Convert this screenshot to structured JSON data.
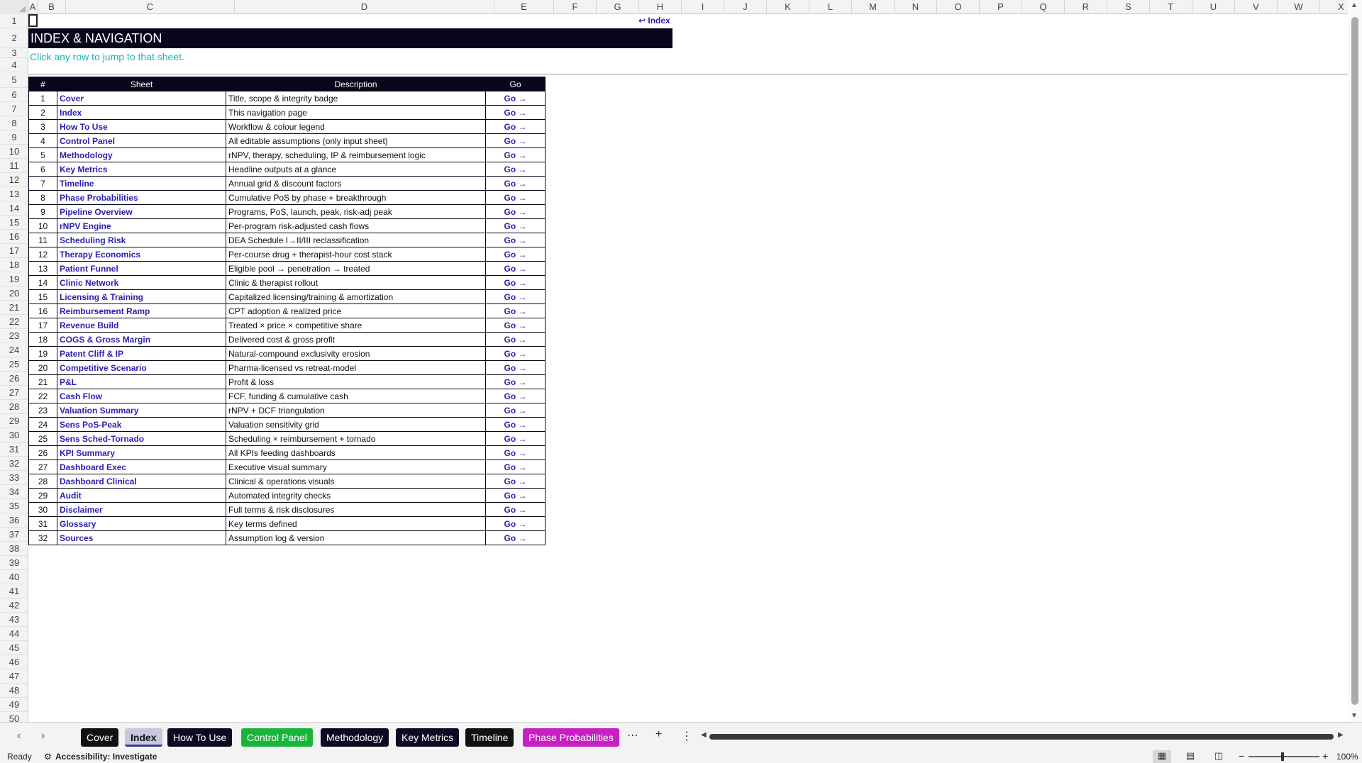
{
  "columns": [
    "A",
    "B",
    "C",
    "D",
    "E",
    "F",
    "G",
    "H",
    "I",
    "J",
    "K",
    "L",
    "M",
    "N",
    "O",
    "P",
    "Q",
    "R",
    "S",
    "T",
    "U",
    "V",
    "W",
    "X"
  ],
  "rows_start": 1,
  "rows_end": 50,
  "back_link": "↩ Index",
  "title": "INDEX & NAVIGATION",
  "subtitle": "Click any row to jump to that sheet.",
  "table": {
    "headers": {
      "num": "#",
      "sheet": "Sheet",
      "desc": "Description",
      "go": "Go"
    },
    "rows": [
      {
        "num": "1",
        "sheet": "Cover",
        "desc": "Title, scope & integrity badge",
        "go": "Go →"
      },
      {
        "num": "2",
        "sheet": "Index",
        "desc": "This navigation page",
        "go": "Go →"
      },
      {
        "num": "3",
        "sheet": "How To Use",
        "desc": "Workflow & colour legend",
        "go": "Go →"
      },
      {
        "num": "4",
        "sheet": "Control Panel",
        "desc": "All editable assumptions (only input sheet)",
        "go": "Go →"
      },
      {
        "num": "5",
        "sheet": "Methodology",
        "desc": "rNPV, therapy, scheduling, IP & reimbursement logic",
        "go": "Go →"
      },
      {
        "num": "6",
        "sheet": "Key Metrics",
        "desc": "Headline outputs at a glance",
        "go": "Go →"
      },
      {
        "num": "7",
        "sheet": "Timeline",
        "desc": "Annual grid & discount factors",
        "go": "Go →"
      },
      {
        "num": "8",
        "sheet": "Phase Probabilities",
        "desc": "Cumulative PoS by phase + breakthrough",
        "go": "Go →"
      },
      {
        "num": "9",
        "sheet": "Pipeline Overview",
        "desc": "Programs, PoS, launch, peak, risk-adj peak",
        "go": "Go →"
      },
      {
        "num": "10",
        "sheet": "rNPV Engine",
        "desc": "Per-program risk-adjusted cash flows",
        "go": "Go →"
      },
      {
        "num": "11",
        "sheet": "Scheduling Risk",
        "desc": "DEA Schedule I→II/III reclassification",
        "go": "Go →"
      },
      {
        "num": "12",
        "sheet": "Therapy Economics",
        "desc": "Per-course drug + therapist-hour cost stack",
        "go": "Go →"
      },
      {
        "num": "13",
        "sheet": "Patient Funnel",
        "desc": "Eligible pool → penetration → treated",
        "go": "Go →"
      },
      {
        "num": "14",
        "sheet": "Clinic Network",
        "desc": "Clinic & therapist rollout",
        "go": "Go →"
      },
      {
        "num": "15",
        "sheet": "Licensing & Training",
        "desc": "Capitalized licensing/training & amortization",
        "go": "Go →"
      },
      {
        "num": "16",
        "sheet": "Reimbursement Ramp",
        "desc": "CPT adoption & realized price",
        "go": "Go →"
      },
      {
        "num": "17",
        "sheet": "Revenue Build",
        "desc": "Treated × price × competitive share",
        "go": "Go →"
      },
      {
        "num": "18",
        "sheet": "COGS & Gross Margin",
        "desc": "Delivered cost & gross profit",
        "go": "Go →"
      },
      {
        "num": "19",
        "sheet": "Patent Cliff & IP",
        "desc": "Natural-compound exclusivity erosion",
        "go": "Go →"
      },
      {
        "num": "20",
        "sheet": "Competitive Scenario",
        "desc": "Pharma-licensed vs retreat-model",
        "go": "Go →"
      },
      {
        "num": "21",
        "sheet": "P&L",
        "desc": "Profit & loss",
        "go": "Go →"
      },
      {
        "num": "22",
        "sheet": "Cash Flow",
        "desc": "FCF, funding & cumulative cash",
        "go": "Go →"
      },
      {
        "num": "23",
        "sheet": "Valuation Summary",
        "desc": "rNPV + DCF triangulation",
        "go": "Go →"
      },
      {
        "num": "24",
        "sheet": "Sens PoS-Peak",
        "desc": "Valuation sensitivity grid",
        "go": "Go →"
      },
      {
        "num": "25",
        "sheet": "Sens Sched-Tornado",
        "desc": "Scheduling × reimbursement + tornado",
        "go": "Go →"
      },
      {
        "num": "26",
        "sheet": "KPI Summary",
        "desc": "All KPIs feeding dashboards",
        "go": "Go →"
      },
      {
        "num": "27",
        "sheet": "Dashboard Exec",
        "desc": "Executive visual summary",
        "go": "Go →"
      },
      {
        "num": "28",
        "sheet": "Dashboard Clinical",
        "desc": "Clinical & operations visuals",
        "go": "Go →"
      },
      {
        "num": "29",
        "sheet": "Audit",
        "desc": "Automated integrity checks",
        "go": "Go →"
      },
      {
        "num": "30",
        "sheet": "Disclaimer",
        "desc": "Full terms & risk disclosures",
        "go": "Go →"
      },
      {
        "num": "31",
        "sheet": "Glossary",
        "desc": "Key terms defined",
        "go": "Go →"
      },
      {
        "num": "32",
        "sheet": "Sources",
        "desc": "Assumption log & version",
        "go": "Go →"
      }
    ]
  },
  "tabs": [
    {
      "label": "Cover",
      "bg": "#111111",
      "active": false
    },
    {
      "label": "Index",
      "bg": "#c7c7de",
      "active": true
    },
    {
      "label": "How To Use",
      "bg": "#0b0a22",
      "active": false
    },
    {
      "label": "Control Panel",
      "bg": "#19b53a",
      "active": false
    },
    {
      "label": "Methodology",
      "bg": "#0b0a22",
      "active": false
    },
    {
      "label": "Key Metrics",
      "bg": "#0b0a22",
      "active": false
    },
    {
      "label": "Timeline",
      "bg": "#111111",
      "active": false
    },
    {
      "label": "Phase Probabilities",
      "bg": "#c81fc4",
      "active": false
    }
  ],
  "tab_controls": {
    "more": "⋯",
    "add": "+",
    "options": "⋮"
  },
  "status": {
    "ready": "Ready",
    "accessibility": "Accessibility: Investigate",
    "zoom": "100%"
  },
  "colors": {
    "header_dark": "#07061a",
    "link": "#2a1fb0",
    "subtitle": "#19b3b8"
  }
}
